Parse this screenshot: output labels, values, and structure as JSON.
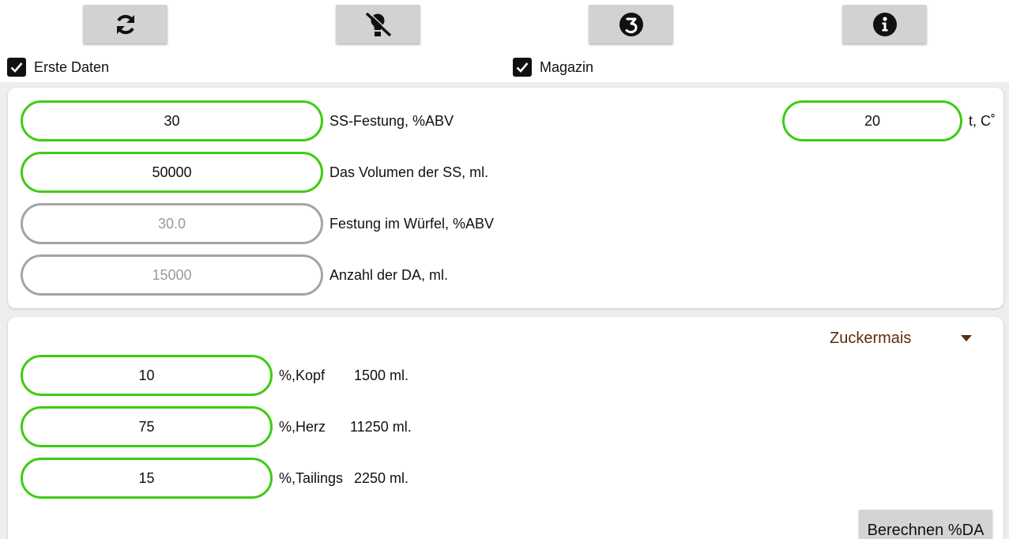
{
  "toolbar": {
    "icons": [
      "refresh-icon",
      "lamp-off-icon",
      "number-three-icon",
      "info-icon"
    ]
  },
  "checkboxes": {
    "first_data": {
      "label": "Erste Daten",
      "checked": true
    },
    "magazine": {
      "label": "Magazin",
      "checked": true
    }
  },
  "card1": {
    "ss_strength": {
      "value": "30",
      "label": "SS-Festung, %ABV"
    },
    "ss_volume": {
      "value": "50000",
      "label": "Das Volumen der SS, ml."
    },
    "cube_strength": {
      "value": "30.0",
      "label": "Festung im Würfel, %ABV"
    },
    "da_amount": {
      "value": "15000",
      "label": "Anzahl der DA, ml."
    },
    "temperature": {
      "value": "20",
      "label": "t, C˚"
    }
  },
  "card2": {
    "raw_material": {
      "selected": "Zuckermais"
    },
    "fractions": [
      {
        "percent": "10",
        "name": "%,Kopf",
        "volume": "1500 ml."
      },
      {
        "percent": "75",
        "name": "%,Herz",
        "volume": "11250 ml."
      },
      {
        "percent": "15",
        "name": "%,Tailings",
        "volume": "2250 ml."
      }
    ],
    "calc_button": "Berechnen %DA"
  },
  "colors": {
    "field_border_active": "#3ecb12",
    "field_border_disabled": "#a4a4a4",
    "dropdown_text": "#5a2d0c",
    "toolbar_button": "#d2d2d2"
  }
}
